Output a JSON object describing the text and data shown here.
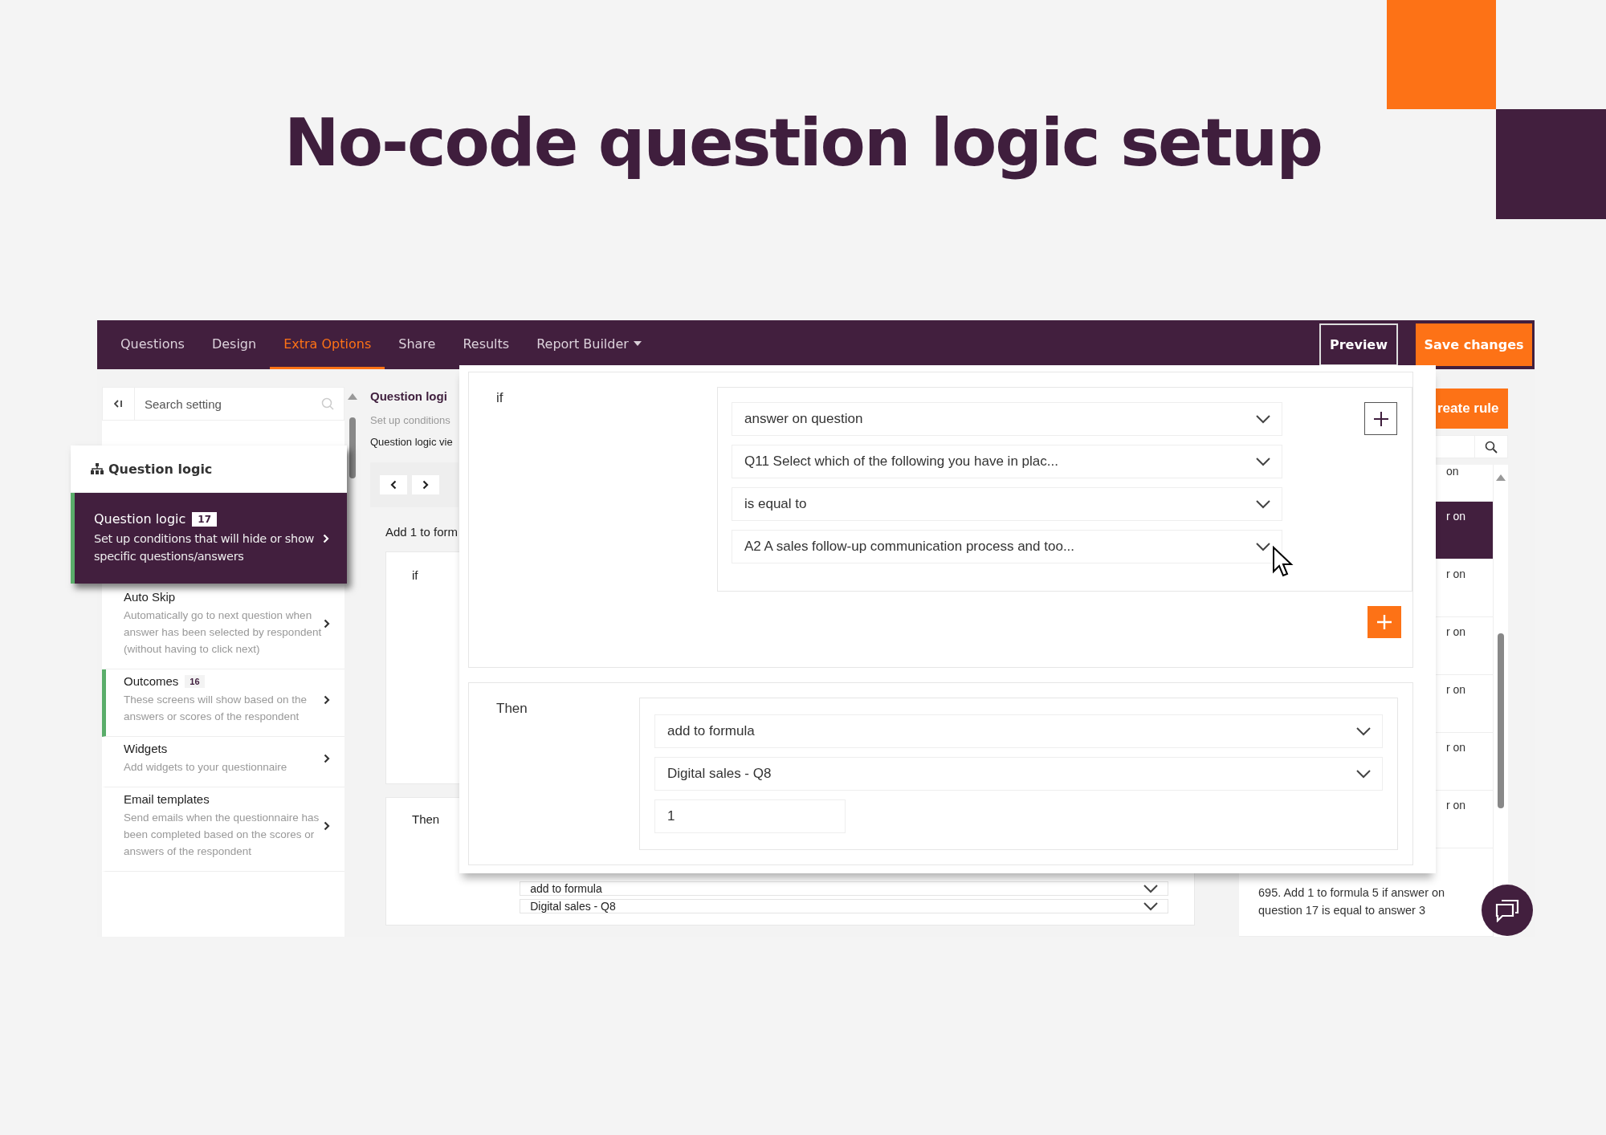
{
  "headline": "No-code question logic setup",
  "nav": {
    "tabs": [
      {
        "label": "Questions",
        "kind": "tab",
        "selected": false
      },
      {
        "label": "Design",
        "kind": "tab",
        "selected": false
      },
      {
        "label": "Extra Options",
        "kind": "tab",
        "selected": true
      },
      {
        "label": "Share",
        "kind": "tab",
        "selected": false
      },
      {
        "label": "Results",
        "kind": "tab",
        "selected": false
      },
      {
        "label": "Report Builder",
        "kind": "dropdown",
        "selected": false
      }
    ],
    "preview_button": "Preview",
    "save_button": "Save changes"
  },
  "settings_sidebar": {
    "search": {
      "placeholder": "Search setting"
    },
    "items": [
      {
        "title": "Auto Skip",
        "description": "Automatically go to next question when answer has been selected by respondent (without having to click next)",
        "highlighted": false
      },
      {
        "title": "Outcomes",
        "badge": "16",
        "description": "These screens will show based on the answers or scores of the respondent",
        "highlighted": true
      },
      {
        "title": "Widgets",
        "description": "Add widgets to your questionnaire",
        "highlighted": false
      },
      {
        "title": "Email templates",
        "description": "Send emails when the questionnaire has been completed based on the scores or answers of the respondent",
        "highlighted": false
      }
    ]
  },
  "logic_panel": {
    "title": "Question logi",
    "subtitle": "Set up conditions",
    "view_label": "Question logic vie",
    "rule_title": "Add 1 to form",
    "if_label": "if",
    "then_label": "Then",
    "dropdowns": [
      "add to formula",
      "Digital sales - Q8"
    ]
  },
  "rules_panel": {
    "create_button": "reate rule",
    "items": [
      {
        "text": "on",
        "kind": "fragment",
        "selected": false
      },
      {
        "text": "r on",
        "kind": "fragment",
        "selected": true
      },
      {
        "text": "r on",
        "kind": "fragment",
        "selected": false
      },
      {
        "text": "r on",
        "kind": "fragment",
        "selected": false
      },
      {
        "text": "r on",
        "kind": "fragment",
        "selected": false
      },
      {
        "text": "r on",
        "kind": "fragment",
        "selected": false
      },
      {
        "text": "r on",
        "kind": "fragment",
        "selected": false
      },
      {
        "text": "695. Add 1 to formula 5 if answer on question 17 is equal to answer 3",
        "kind": "full",
        "selected": false
      }
    ]
  },
  "focus_popup": {
    "header": "Question logic",
    "item": {
      "title": "Question logic",
      "badge": "17",
      "description": "Set up conditions that will hide or show specific questions/answers",
      "selected": true
    }
  },
  "rule_editor": {
    "if_label": "if",
    "conditions": [
      "answer on question",
      "Q11 Select which of the following you have in plac...",
      "is equal to",
      "A2 A sales follow-up communication process and too..."
    ],
    "then_label": "Then",
    "actions": [
      {
        "kind": "dropdown",
        "value": "add to formula"
      },
      {
        "kind": "dropdown",
        "value": "Digital sales - Q8"
      },
      {
        "kind": "input",
        "value": "1"
      }
    ]
  }
}
